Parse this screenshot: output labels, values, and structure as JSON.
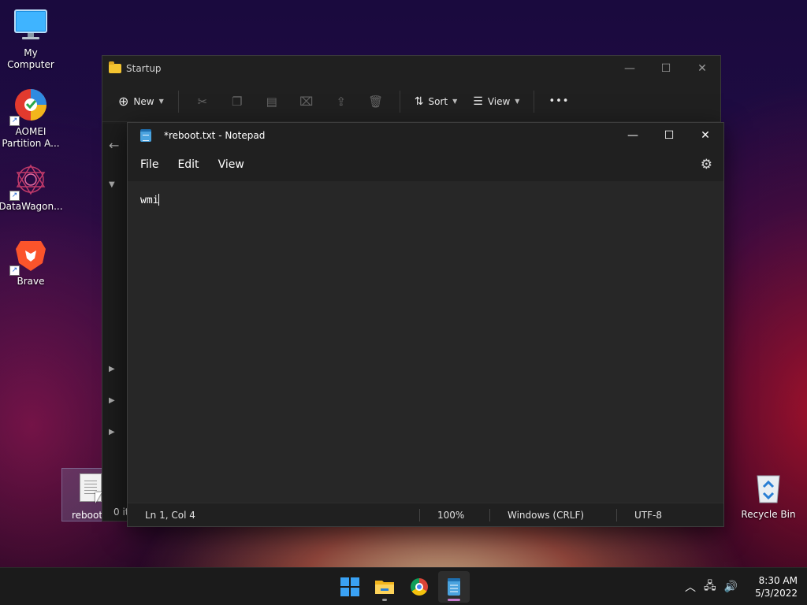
{
  "desktop": {
    "icons": [
      {
        "label": "My Computer"
      },
      {
        "label": "AOMEI Partition A..."
      },
      {
        "label": "DataWagon..."
      },
      {
        "label": "Brave"
      },
      {
        "label": "Recycle Bin"
      }
    ],
    "file": {
      "label": "reboot."
    }
  },
  "explorer": {
    "title": "Startup",
    "toolbar": {
      "new_label": "New",
      "sort_label": "Sort",
      "view_label": "View",
      "more_label": "•••"
    },
    "status": "0 it"
  },
  "notepad": {
    "title": "*reboot.txt - Notepad",
    "menu": {
      "file": "File",
      "edit": "Edit",
      "view": "View"
    },
    "content": "wmi",
    "status": {
      "position": "Ln 1, Col 4",
      "zoom": "100%",
      "line_ending": "Windows (CRLF)",
      "encoding": "UTF-8"
    }
  },
  "taskbar": {
    "time": "8:30 AM",
    "date": "5/3/2022"
  },
  "colors": {
    "accent": "#3aa2f5",
    "window_bg": "#272727",
    "titlebar_bg": "#202020"
  }
}
